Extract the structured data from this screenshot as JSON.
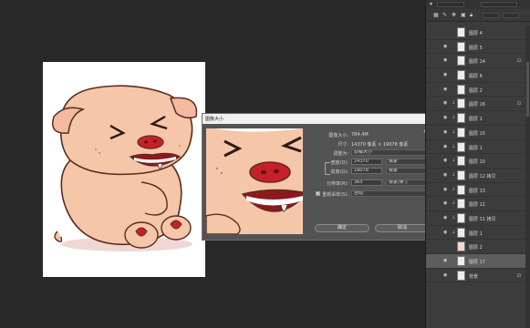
{
  "dialog": {
    "title": "图像大小",
    "close_glyph": "×",
    "image_size_label": "图像大小:",
    "image_size_value": "784.4M",
    "dimensions_label": "尺寸:",
    "dimensions_value": "14370 像素 × 19078 像素",
    "fit_to_label": "调整为:",
    "fit_to_value": "原稿大小",
    "width_label": "宽度(D):",
    "width_value": "14370",
    "width_unit": "像素",
    "height_label": "高度(G):",
    "height_value": "19078",
    "height_unit": "像素",
    "resolution_label": "分辨率(R):",
    "resolution_value": "365",
    "resolution_unit": "像素/英寸",
    "resample_label": "重新采样(S):",
    "resample_value": "自动",
    "resample_checked": true,
    "ok_label": "确定",
    "cancel_label": "取消"
  },
  "layers_toolbar": {
    "search_placeholder": "",
    "mode_placeholder": ""
  },
  "layers": [
    {
      "name": "图层 4",
      "visible": false,
      "thumb": "white",
      "chain": false,
      "lock": false
    },
    {
      "name": "图层 5",
      "visible": true,
      "thumb": "white",
      "chain": false,
      "lock": false
    },
    {
      "name": "图层 14",
      "visible": true,
      "thumb": "white",
      "chain": false,
      "lock": true
    },
    {
      "name": "图层 6",
      "visible": true,
      "thumb": "white",
      "chain": false,
      "lock": false
    },
    {
      "name": "图层 2",
      "visible": true,
      "thumb": "white",
      "chain": false,
      "lock": false
    },
    {
      "name": "图层 16",
      "visible": true,
      "thumb": "white",
      "chain": true,
      "lock": true
    },
    {
      "name": "图层 1",
      "visible": true,
      "thumb": "white",
      "chain": true,
      "lock": false
    },
    {
      "name": "图层 15",
      "visible": true,
      "thumb": "white",
      "chain": true,
      "lock": false
    },
    {
      "name": "图层 1",
      "visible": true,
      "thumb": "white",
      "chain": true,
      "lock": false
    },
    {
      "name": "图层 10",
      "visible": true,
      "thumb": "white",
      "chain": true,
      "lock": false
    },
    {
      "name": "图层 12 拷贝",
      "visible": true,
      "thumb": "white",
      "chain": true,
      "lock": false
    },
    {
      "name": "图层 13",
      "visible": true,
      "thumb": "white",
      "chain": true,
      "lock": false
    },
    {
      "name": "图层 11",
      "visible": true,
      "thumb": "white",
      "chain": true,
      "lock": false
    },
    {
      "name": "图层 11 拷贝",
      "visible": true,
      "thumb": "white",
      "chain": true,
      "lock": false
    },
    {
      "name": "图层 1",
      "visible": true,
      "thumb": "white",
      "chain": true,
      "lock": false
    },
    {
      "name": "图层 2",
      "visible": false,
      "thumb": "pink",
      "chain": false,
      "lock": false
    },
    {
      "name": "图层 17",
      "visible": true,
      "thumb": "white",
      "chain": false,
      "lock": false,
      "selected": true
    },
    {
      "name": "背景",
      "visible": true,
      "thumb": "white",
      "chain": false,
      "lock": true
    }
  ]
}
